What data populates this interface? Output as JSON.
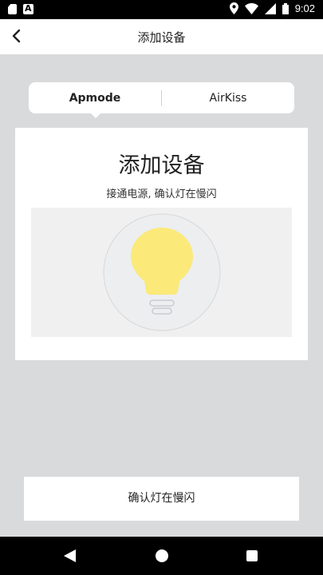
{
  "status_bar": {
    "time": "9:02",
    "icons": [
      "sd-card-icon",
      "a-notification-icon",
      "location-icon",
      "wifi-icon",
      "signal-icon",
      "battery-icon"
    ]
  },
  "app_bar": {
    "title": "添加设备",
    "back_icon": "chevron-left-icon"
  },
  "mode_tabs": [
    {
      "label": "Apmode",
      "active": true
    },
    {
      "label": "AirKiss",
      "active": false
    }
  ],
  "card": {
    "title": "添加设备",
    "subtitle": "接通电源, 确认灯在慢闪",
    "illustration": "light-bulb-icon"
  },
  "confirm_button": {
    "label": "确认灯在慢闪"
  },
  "nav_bar": {
    "icons": [
      "back-triangle-icon",
      "home-circle-icon",
      "recents-square-icon"
    ]
  },
  "colors": {
    "background": "#d9dadb",
    "bulb": "#fbe97a",
    "bulb_halo": "#eceef0"
  }
}
